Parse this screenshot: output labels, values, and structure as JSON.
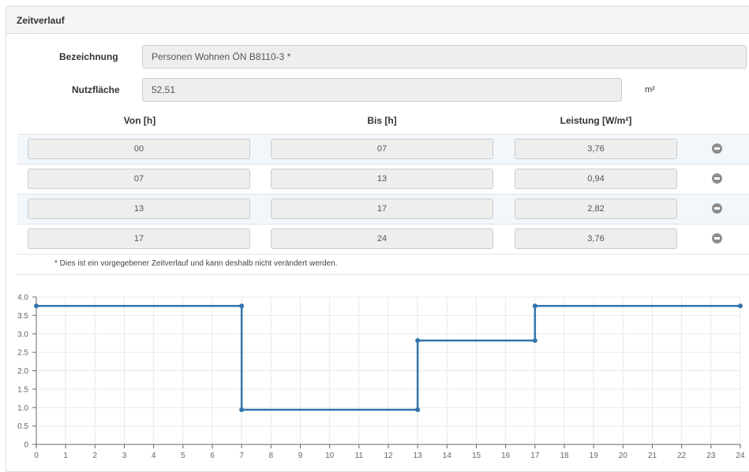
{
  "panel": {
    "title": "Zeitverlauf"
  },
  "form": {
    "bezeichnung_label": "Bezeichnung",
    "bezeichnung_value": "Personen Wohnen ÖN B8110-3 *",
    "nutzflaeche_label": "Nutzfläche",
    "nutzflaeche_value": "52,51",
    "nutzflaeche_unit": "m²"
  },
  "table": {
    "headers": {
      "von": "Von [h]",
      "bis": "Bis [h]",
      "leistung": "Leistung [W/m²]"
    },
    "rows": [
      {
        "von": "00",
        "bis": "07",
        "leistung": "3,76"
      },
      {
        "von": "07",
        "bis": "13",
        "leistung": "0,94"
      },
      {
        "von": "13",
        "bis": "17",
        "leistung": "2,82"
      },
      {
        "von": "17",
        "bis": "24",
        "leistung": "3,76"
      }
    ],
    "remove_icon": "minus-circle-icon"
  },
  "note": "* Dies ist ein vorgegebener Zeitverlauf und kann deshalb nicht verändert werden.",
  "colors": {
    "line": "#3274ad",
    "grid": "#e8e8e8",
    "axis": "#666666"
  },
  "chart_data": {
    "type": "line",
    "title": "",
    "xlabel": "",
    "ylabel": "",
    "xlim": [
      0,
      24
    ],
    "ylim": [
      0,
      4
    ],
    "grid": true,
    "x_ticks": [
      "0",
      "1",
      "2",
      "3",
      "4",
      "5",
      "6",
      "7",
      "8",
      "9",
      "10",
      "11",
      "12",
      "13",
      "14",
      "15",
      "16",
      "17",
      "18",
      "19",
      "20",
      "21",
      "22",
      "23",
      "24"
    ],
    "y_ticks": [
      "0",
      "0.5",
      "1.0",
      "1.5",
      "2.0",
      "2.5",
      "3.0",
      "3.5",
      "4.0"
    ],
    "series": [
      {
        "x": [
          0,
          7,
          7,
          13,
          13,
          17,
          17,
          24
        ],
        "y": [
          3.76,
          3.76,
          0.94,
          0.94,
          2.82,
          2.82,
          3.76,
          3.76
        ]
      }
    ]
  }
}
